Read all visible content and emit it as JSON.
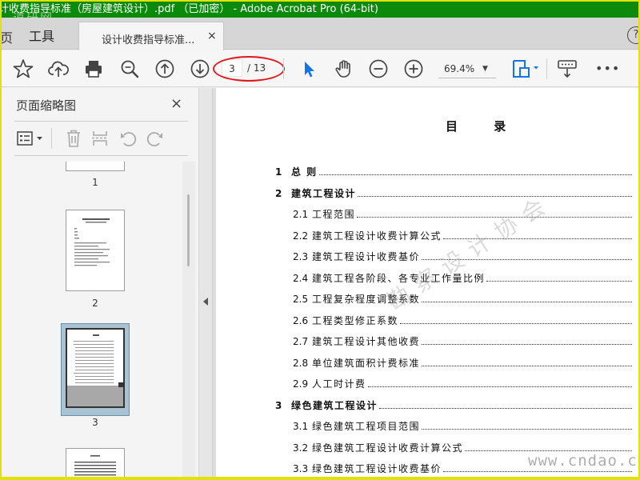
{
  "window": {
    "title": "计收费指导标准（房屋建筑设计）.pdf （已加密） - Adobe Acrobat Pro (64-bit)",
    "watermark_topleft": "道研网"
  },
  "tabs": {
    "left_fragment": "页",
    "tools": "工具",
    "doc_title": "设计收费指导标准...",
    "doc_close": "×",
    "help": "?"
  },
  "toolbar": {
    "icons": [
      "star-icon",
      "upload-cloud-icon",
      "print-icon",
      "zoom-search-icon",
      "page-up-icon",
      "page-down-icon",
      "select-arrow-icon",
      "hand-icon",
      "zoom-out-icon",
      "zoom-in-icon",
      "fit-page-icon",
      "scroll-mode-icon",
      "more-icon"
    ],
    "current_page": "3",
    "total_pages": "/ 13",
    "zoom": "69.4%",
    "zoom_arrow": "▼",
    "more": "•••",
    "accent_color": "#1473e6",
    "highlight_color": "#e2181f"
  },
  "panel": {
    "title": "页面缩略图",
    "close": "×",
    "tool_icons": [
      "options-menu-icon",
      "delete-icon",
      "extract-icon",
      "undo-rotate-icon",
      "redo-rotate-icon"
    ],
    "thumbnails": [
      {
        "label": "1"
      },
      {
        "label": "2"
      },
      {
        "label": "3"
      },
      {
        "label": ""
      }
    ]
  },
  "document": {
    "toc_title": "目 录",
    "entries": [
      {
        "num": "1",
        "text": "总 则"
      },
      {
        "num": "2",
        "text": "建筑工程设计"
      },
      {
        "num": "2.1",
        "text": "工程范围"
      },
      {
        "num": "2.2",
        "text": "建筑工程设计收费计算公式"
      },
      {
        "num": "2.3",
        "text": "建筑工程设计收费基价"
      },
      {
        "num": "2.4",
        "text": "建筑工程各阶段、各专业工作量比例"
      },
      {
        "num": "2.5",
        "text": "工程复杂程度调整系数"
      },
      {
        "num": "2.6",
        "text": "工程类型修正系数"
      },
      {
        "num": "2.7",
        "text": "建筑工程设计其他收费"
      },
      {
        "num": "2.8",
        "text": "单位建筑面积计费标准"
      },
      {
        "num": "2.9",
        "text": "人工时计费"
      },
      {
        "num": "3",
        "text": "绿色建筑工程设计"
      },
      {
        "num": "3.1",
        "text": "绿色建筑工程项目范围"
      },
      {
        "num": "3.2",
        "text": "绿色建筑工程设计收费计算公式"
      },
      {
        "num": "3.3",
        "text": "绿色建筑工程设计收费基价"
      }
    ],
    "watermark_diagonal": "勘察设计协会",
    "watermark_url": "www.cndao.com"
  }
}
